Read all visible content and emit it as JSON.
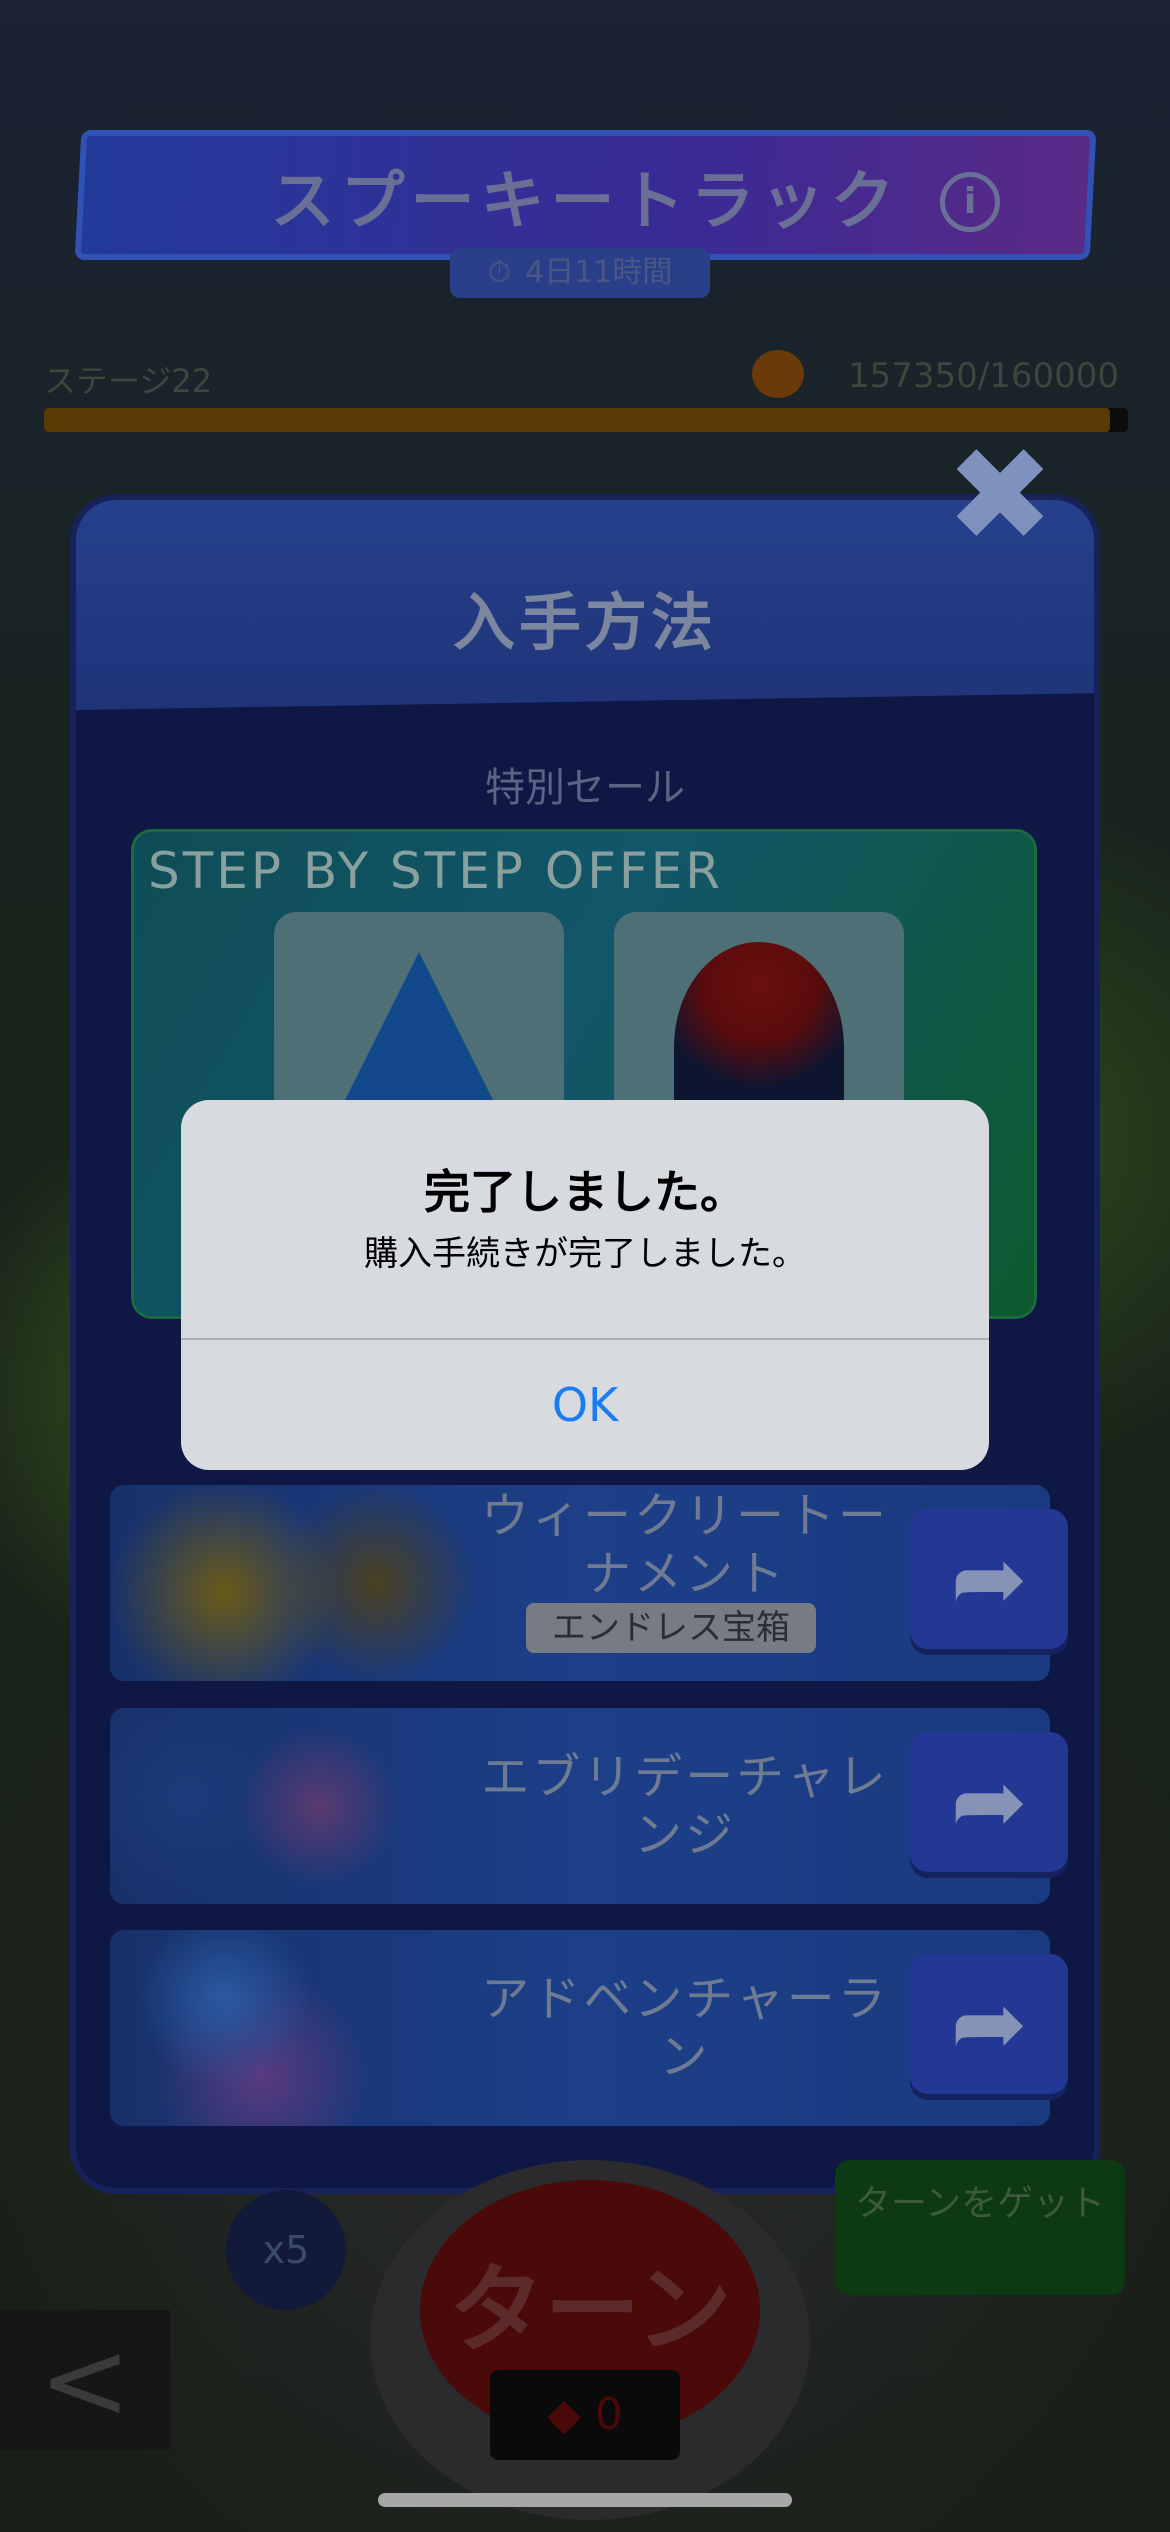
{
  "event": {
    "title": "スプーキートラック",
    "timer": "4日11時間"
  },
  "progress": {
    "stage": "ステージ22",
    "points": "157350/160000",
    "fraction": 0.9834
  },
  "dialog": {
    "title": "入手方法",
    "close_glyph": "✖",
    "section_label": "特別セール",
    "offer_title": "STEP BY STEP OFFER"
  },
  "alert": {
    "title": "完了しました。",
    "message": "購入手続きが完了しました。",
    "ok_label": "OK"
  },
  "rows": [
    {
      "title": "ウィークリートーナメント",
      "tag": "エンドレス宝箱"
    },
    {
      "title": "エブリデーチャレンジ"
    },
    {
      "title": "アドベンチャーラン"
    }
  ],
  "controls": {
    "spin_label": "ターン",
    "multiplier": "x5",
    "get_turns": "ターンをゲット",
    "back_glyph": "<",
    "dice_count": "0"
  },
  "colors": {
    "ok_blue": "#1a7cf5",
    "dialog_bg": "#0f1744"
  }
}
